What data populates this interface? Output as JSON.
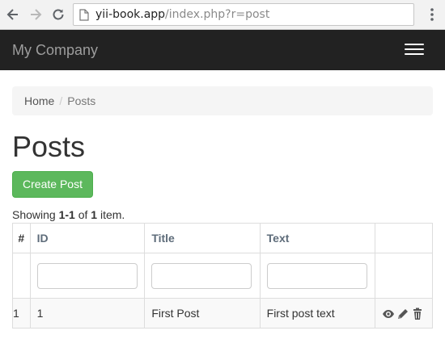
{
  "browser": {
    "url_host": "yii-book.app",
    "url_path": "/index.php?r=post",
    "icons": [
      "back-icon",
      "forward-icon",
      "reload-icon",
      "page-icon",
      "menu-icon"
    ]
  },
  "navbar": {
    "brand": "My Company",
    "background": "#222222"
  },
  "breadcrumb": {
    "home": "Home",
    "separator": "/",
    "current": "Posts"
  },
  "page": {
    "title": "Posts",
    "create_button": "Create Post",
    "accent": "#5cb85c"
  },
  "summary": {
    "prefix": "Showing ",
    "range": "1-1",
    "of": " of ",
    "total": "1",
    "suffix": " item."
  },
  "grid": {
    "columns": [
      "#",
      "ID",
      "Title",
      "Text",
      ""
    ],
    "filters": {
      "id": "",
      "title": "",
      "text": ""
    },
    "rows": [
      {
        "num": "1",
        "id": "1",
        "title": "First Post",
        "text": "First post text",
        "actions": [
          "view-icon",
          "update-icon",
          "delete-icon"
        ]
      }
    ]
  }
}
